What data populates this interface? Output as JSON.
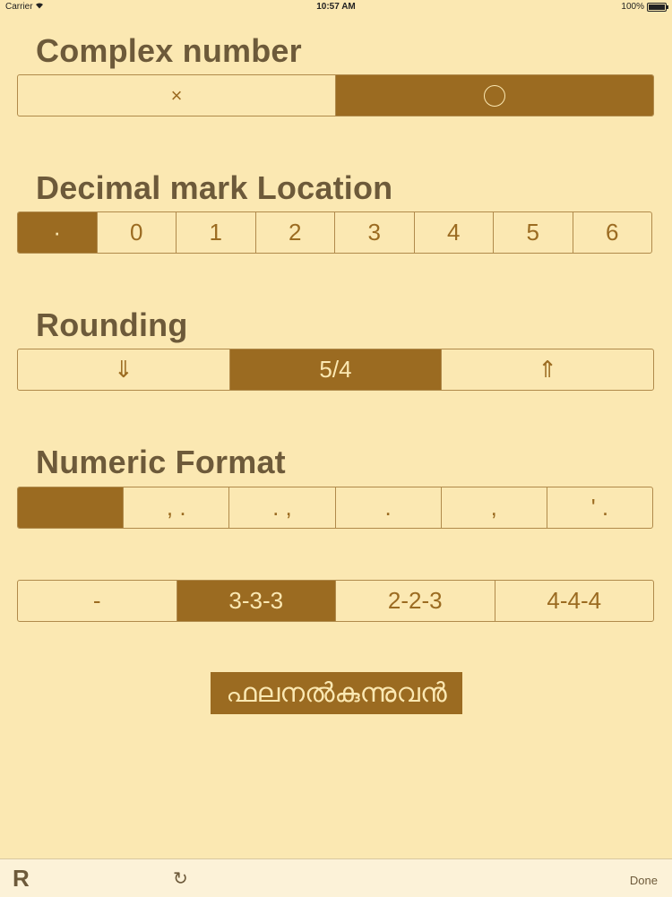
{
  "status_bar": {
    "carrier": "Carrier",
    "wifi_icon": "wifi-icon",
    "time": "10:57 AM",
    "battery": "100%"
  },
  "complex_number": {
    "title": "Complex number",
    "options": [
      {
        "label": "×",
        "selected": false
      },
      {
        "icon": "circle-icon",
        "selected": true
      }
    ]
  },
  "decimal_mark": {
    "title": "Decimal mark Location",
    "options": [
      {
        "label": "·",
        "selected": true
      },
      {
        "label": "0",
        "selected": false
      },
      {
        "label": "1",
        "selected": false
      },
      {
        "label": "2",
        "selected": false
      },
      {
        "label": "3",
        "selected": false
      },
      {
        "label": "4",
        "selected": false
      },
      {
        "label": "5",
        "selected": false
      },
      {
        "label": "6",
        "selected": false
      }
    ]
  },
  "rounding": {
    "title": "Rounding",
    "options": [
      {
        "label": "⇓",
        "selected": false
      },
      {
        "label": "5/4",
        "selected": true
      },
      {
        "label": "⇑",
        "selected": false
      }
    ]
  },
  "numeric_format": {
    "title": "Numeric Format",
    "separators": [
      {
        "label": "",
        "selected": true
      },
      {
        "label": ", .",
        "selected": false
      },
      {
        "label": ". ,",
        "selected": false
      },
      {
        "label": ".",
        "selected": false
      },
      {
        "label": ",",
        "selected": false
      },
      {
        "label": "' .",
        "selected": false
      }
    ],
    "grouping": [
      {
        "label": "-",
        "selected": false
      },
      {
        "label": "3-3-3",
        "selected": true
      },
      {
        "label": "2-2-3",
        "selected": false
      },
      {
        "label": "4-4-4",
        "selected": false
      }
    ]
  },
  "main_button": {
    "label": "ഫലനൽകുന്നുവൻ"
  },
  "toolbar": {
    "logo": "R",
    "refresh_icon": "↻",
    "done": "Done"
  },
  "colors": {
    "background": "#fbe8b2",
    "accent": "#9b6b21",
    "title": "#6d5a3a"
  }
}
